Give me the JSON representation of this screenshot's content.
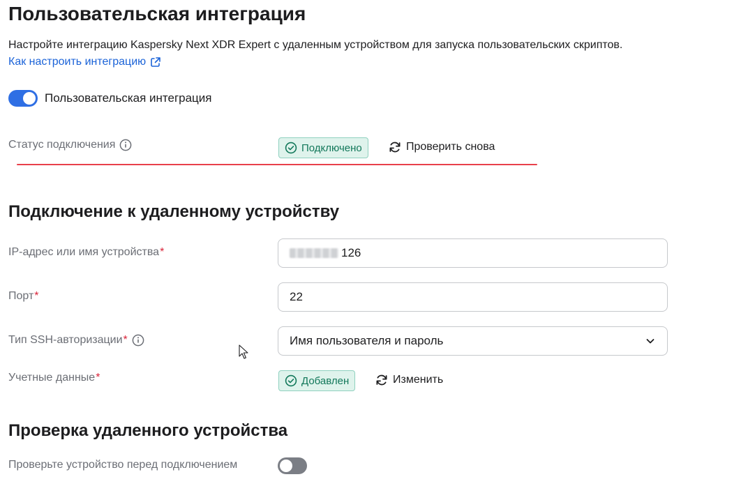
{
  "header": {
    "title": "Пользовательская интеграция",
    "description": "Настройте интеграцию Kaspersky Next XDR Expert с удаленным устройством для запуска пользовательских скриптов.",
    "help_link": "Как настроить интеграцию"
  },
  "integration_toggle": {
    "label": "Пользовательская интеграция",
    "state": "on"
  },
  "connection_status": {
    "label": "Статус подключения",
    "badge": "Подключено",
    "action": "Проверить снова"
  },
  "remote_connection": {
    "title": "Подключение к удаленному устройству",
    "host": {
      "label": "IP-адрес или имя устройства",
      "value_visible": "126"
    },
    "port": {
      "label": "Порт",
      "value": "22"
    },
    "ssh_auth": {
      "label": "Тип SSH-авторизации",
      "selected": "Имя пользователя и пароль"
    },
    "credentials": {
      "label": "Учетные данные",
      "badge": "Добавлен",
      "action": "Изменить"
    },
    "required_mark": "*"
  },
  "remote_verification": {
    "title": "Проверка удаленного устройства",
    "toggle_label": "Проверьте устройство перед подключением",
    "state": "off"
  },
  "colors": {
    "accent": "#2f6fe4",
    "link": "#1b63d8",
    "success_bg": "#dff3ec",
    "success_text": "#12785a",
    "required": "#d9243a",
    "annotation_line": "#e8404b"
  },
  "icons": [
    "external-link-icon",
    "info-icon",
    "check-circle-icon",
    "refresh-icon",
    "chevron-down-icon",
    "mouse-cursor-icon"
  ]
}
